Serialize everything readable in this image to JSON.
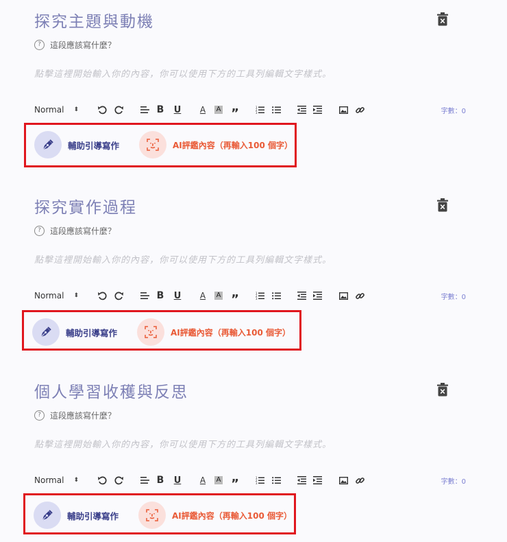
{
  "sections": [
    {
      "title": "探究主題與動機",
      "hint": "這段應該寫什麼？",
      "placeholder": "點擊這裡開始輸入你的內容，你可以使用下方的工具列編輯文字樣式。",
      "format": "Normal",
      "word_count": "字數：0",
      "guide_button": "輔助引導寫作",
      "ai_button": "AI評鑑內容（再輸入100 個字）"
    },
    {
      "title": "探究實作過程",
      "hint": "這段應該寫什麼？",
      "placeholder": "點擊這裡開始輸入你的內容，你可以使用下方的工具列編輯文字樣式。",
      "format": "Normal",
      "word_count": "字數：0",
      "guide_button": "輔助引導寫作",
      "ai_button": "AI評鑑內容（再輸入100 個字）"
    },
    {
      "title": "個人學習收穫與反思",
      "hint": "這段應該寫什麼？",
      "placeholder": "點擊這裡開始輸入你的內容，你可以使用下方的工具列編輯文字樣式。",
      "format": "Normal",
      "word_count": "字數：0",
      "guide_button": "輔助引導寫作",
      "ai_button": "AI評鑑內容（再輸入100 個字）"
    }
  ],
  "toolbar_icons": [
    "undo-icon",
    "redo-icon",
    "align-icon",
    "bold-icon",
    "underline-icon",
    "text-color-icon",
    "highlight-icon",
    "blockquote-icon",
    "ordered-list-icon",
    "bullet-list-icon",
    "outdent-icon",
    "indent-icon",
    "image-icon",
    "link-icon"
  ],
  "colors": {
    "title": "#7d80b5",
    "accent_blue": "#3a3f8a",
    "accent_orange": "#e95a36",
    "highlight_border": "#e0161e",
    "word_count": "#7b7fd1"
  }
}
